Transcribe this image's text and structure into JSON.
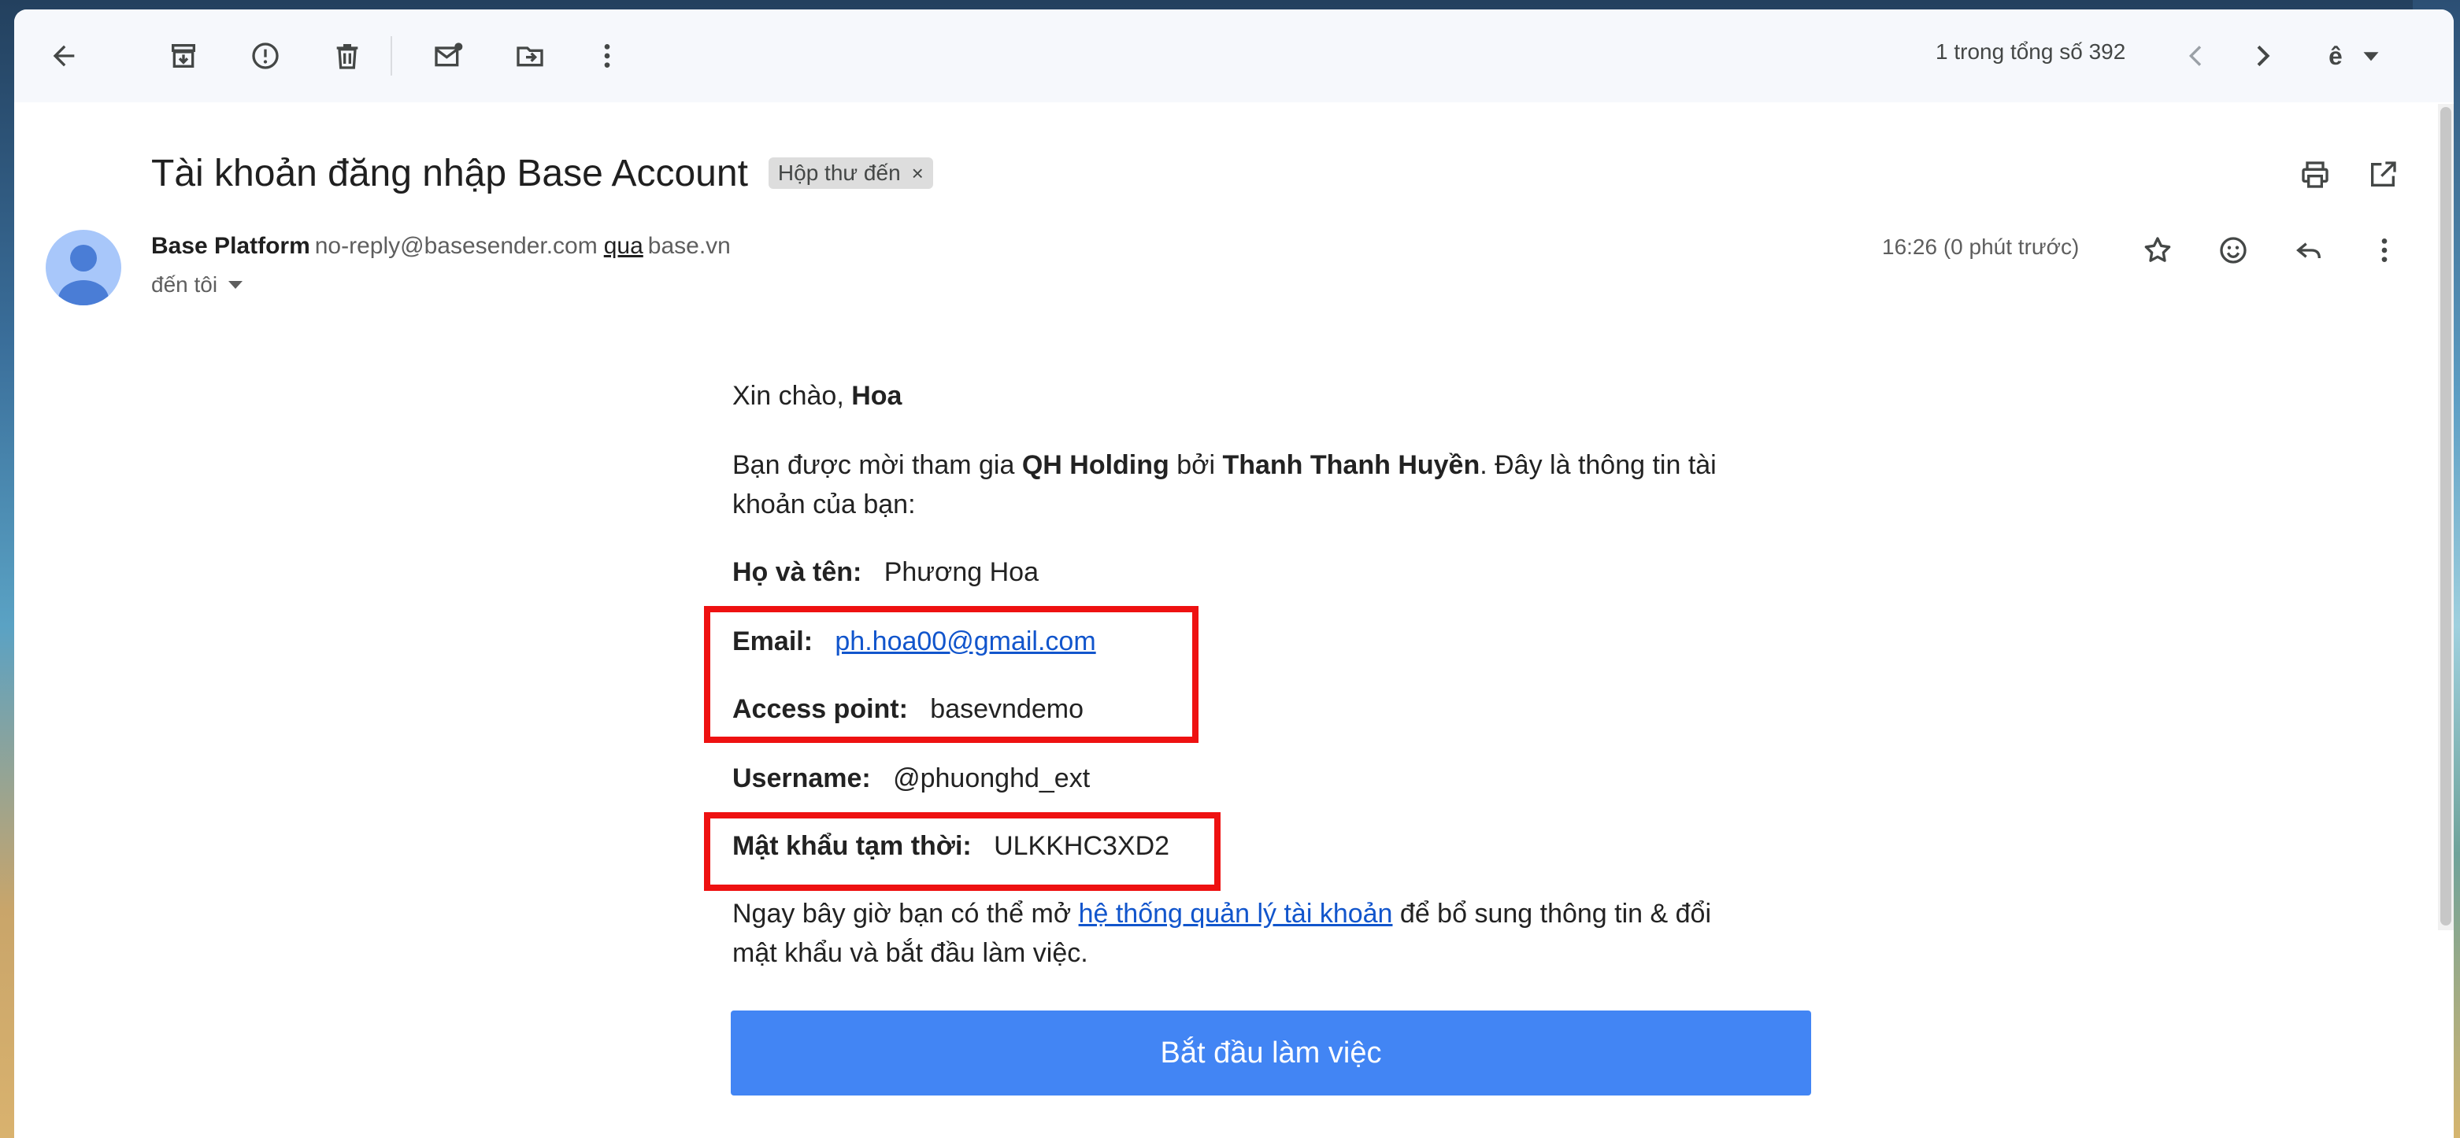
{
  "toolbar": {
    "pager_text": "1 trong tổng số 392",
    "icons": [
      "back-arrow-icon",
      "archive-icon",
      "report-spam-icon",
      "delete-icon",
      "mark-unread-icon",
      "move-to-icon",
      "more-vert-icon",
      "chevron-left-icon",
      "chevron-right-icon",
      "input-tools-icon"
    ]
  },
  "email": {
    "subject": "Tài khoản đăng nhập Base Account",
    "label": "Hộp thư đến",
    "label_remove": "×",
    "sender_name": "Base Platform",
    "sender_email": "no-reply@basesender.com",
    "via_text": "qua",
    "via_domain": "base.vn",
    "recipient": "đến tôi",
    "time": "16:26 (0 phút trước)"
  },
  "body": {
    "greeting_prefix": "Xin chào, ",
    "greeting_name": "Hoa",
    "invite_1": "Bạn được mời tham gia ",
    "invite_org": "QH Holding",
    "invite_2": " bởi ",
    "invite_person": "Thanh Thanh Huyền",
    "invite_3": ". Đây là thông tin tài",
    "invite_4": "khoản của bạn:",
    "name_label": "Họ và tên:",
    "name_value": "Phương Hoa",
    "email_label": "Email:",
    "email_value": "ph.hoa00@gmail.com",
    "access_label": "Access point:",
    "access_value": "basevndemo",
    "username_label": "Username:",
    "username_value": "@phuonghd_ext",
    "password_label": "Mật khẩu tạm thời:",
    "password_value": "ULKKHC3XD2",
    "info_1": "Ngay bây giờ bạn có thể mở ",
    "info_link": "hệ thống quản lý tài khoản",
    "info_2": " để bổ sung thông tin & đổi",
    "info_3": "mật khẩu và bắt đầu làm việc.",
    "cta": "Bắt đầu làm việc"
  },
  "colors": {
    "accent": "#4285f4",
    "link": "#1155cc",
    "highlight": "#ee1111",
    "toolbar_bg": "#f6f8fc"
  }
}
